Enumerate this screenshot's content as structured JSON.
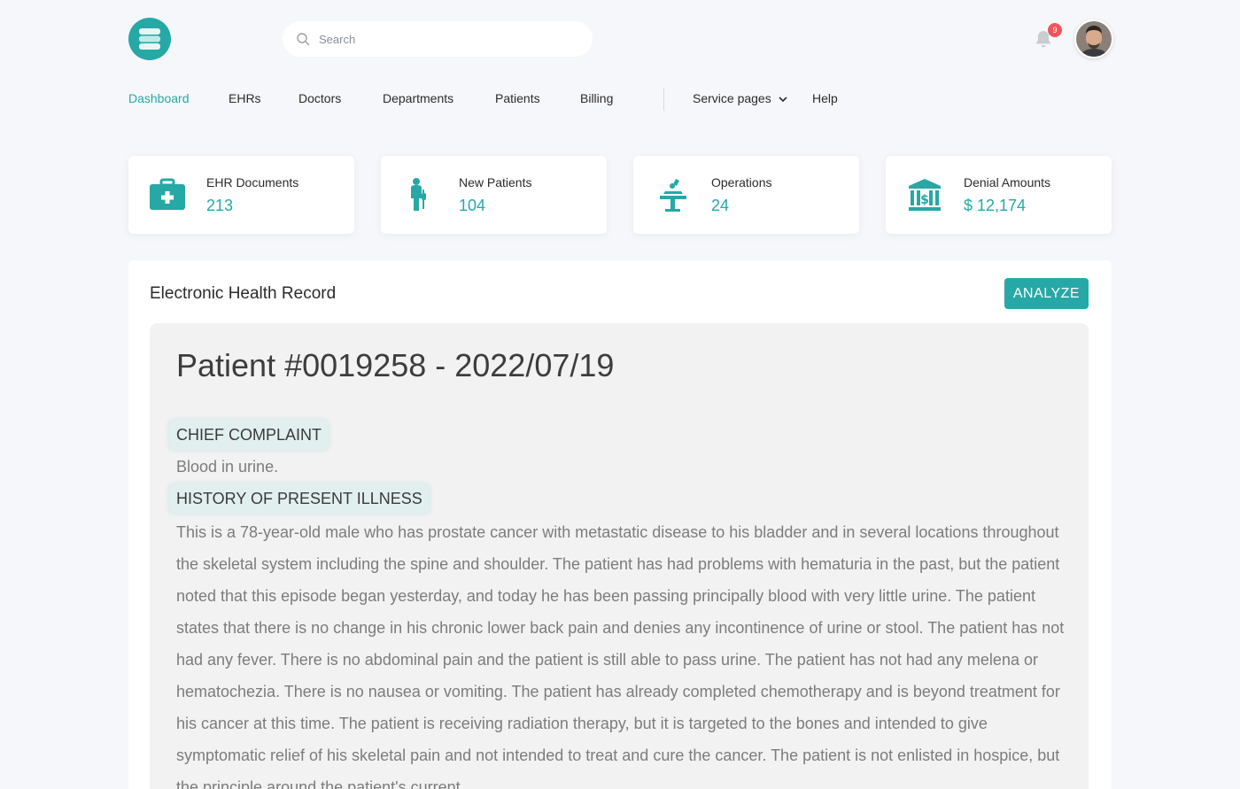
{
  "header": {
    "search_placeholder": "Search",
    "notification_count": "9"
  },
  "nav": {
    "items": [
      "Dashboard",
      "EHRs",
      "Doctors",
      "Departments",
      "Patients",
      "Billing",
      "Service pages",
      "Help"
    ],
    "active": "Dashboard"
  },
  "stats": [
    {
      "label": "EHR Documents",
      "value": "213",
      "icon": "medical-kit-icon"
    },
    {
      "label": "New Patients",
      "value": "104",
      "icon": "patient-icon"
    },
    {
      "label": "Operations",
      "value": "24",
      "icon": "operation-icon"
    },
    {
      "label": "Denial Amounts",
      "value": "$ 12,174",
      "icon": "bank-icon"
    }
  ],
  "record": {
    "panel_title": "Electronic Health Record",
    "analyze_label": "ANALYZE",
    "doc_title": "Patient #0019258 - 2022/07/19",
    "sections": [
      {
        "heading": "CHIEF COMPLAINT",
        "text": "Blood in urine."
      },
      {
        "heading": "HISTORY OF PRESENT ILLNESS",
        "text": "This is a 78-year-old male who has prostate cancer with metastatic disease to his bladder and in several locations throughout the skeletal system including the spine and shoulder. The patient has had problems with hematuria in the past, but the patient noted that this episode began yesterday, and today he has been passing principally blood with very little urine. The patient states that there is no change in his chronic lower back pain and denies any incontinence of urine or stool. The patient has not had any fever. There is no abdominal pain and the patient is still able to pass urine. The patient has not had any melena or hematochezia. There is no nausea or vomiting. The patient has already completed chemotherapy and is beyond treatment for his cancer at this time.  The patient is receiving radiation therapy, but it is targeted to the bones and intended to give symptomatic relief of his skeletal pain and not intended to treat and cure the cancer.  The patient is not enlisted in hospice, but the principle around the patient's current"
      }
    ]
  },
  "colors": {
    "accent": "#26a8a6",
    "badge": "#f0555a"
  }
}
